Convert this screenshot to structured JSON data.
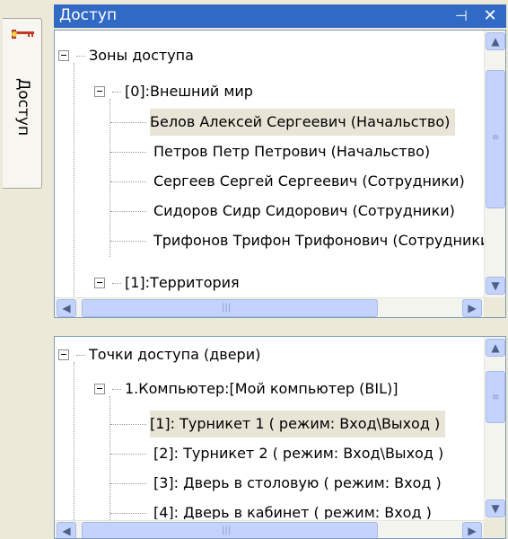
{
  "dock": {
    "tab_label": "Доступ"
  },
  "panel": {
    "title": "Доступ",
    "pin_glyph": "⊣",
    "close_glyph": "✕"
  },
  "zones": {
    "root": "Зоны доступа",
    "group0": "[0]:Внешний мир",
    "people": [
      "Белов Алексей Сергеевич (Начальство)",
      "Петров Петр Петрович (Начальство)",
      "Сергеев Сергей Сергеевич (Сотрудники)",
      "Сидоров Сидр Сидорович (Сотрудники)",
      "Трифонов Трифон Трифонович (Сотрудники)"
    ],
    "group1": "[1]:Территория"
  },
  "points": {
    "root": "Точки доступа (двери)",
    "computer": "1.Компьютер:[Мой компьютер (BIL)]",
    "doors": [
      "[1]: Турникет 1 ( режим: Вход\\Выход )",
      "[2]: Турникет 2 ( режим: Вход\\Выход )",
      "[3]: Дверь в столовую ( режим: Вход )",
      "[4]: Дверь в кабинет ( режим: Вход )"
    ]
  },
  "scroll": {
    "up": "▲",
    "down": "▼",
    "left": "◀",
    "right": "▶",
    "grip_v": "≡",
    "grip_h": "|||"
  },
  "colors": {
    "titlebar": "#316ac5",
    "selection": "#e8e4d6",
    "scroll_button": "#c3d3fd"
  }
}
